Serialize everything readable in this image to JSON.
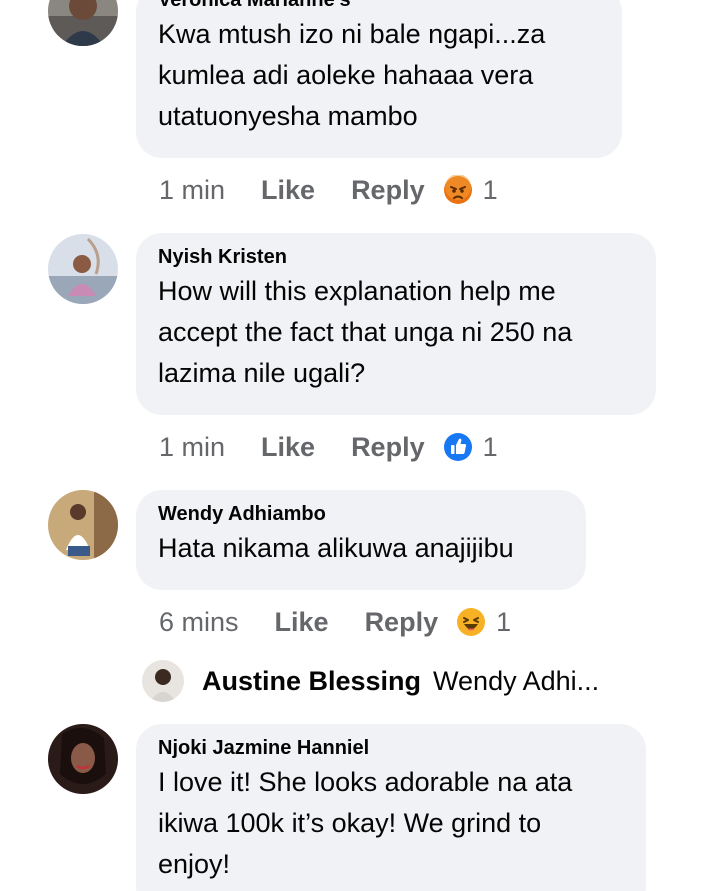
{
  "comments": [
    {
      "author": "Veronica Marianne's",
      "lines": [
        "Kwa mtush izo ni bale ngapi...za",
        "kumlea adi aoleke hahaaa vera",
        "utatuonyesha mambo"
      ],
      "time": "1 min",
      "like": "Like",
      "reply": "Reply",
      "reaction_icon": "angry-emoji-icon",
      "reaction_count": "1"
    },
    {
      "author": "Nyish Kristen",
      "lines": [
        "How will this explanation help me",
        "accept the fact that unga ni 250 na",
        "lazima nile ugali?"
      ],
      "time": "1 min",
      "like": "Like",
      "reply": "Reply",
      "reaction_icon": "thumbs-up-icon",
      "reaction_count": "1"
    },
    {
      "author": "Wendy Adhiambo",
      "lines": [
        "Hata nikama alikuwa anajijibu"
      ],
      "time": "6 mins",
      "like": "Like",
      "reply": "Reply",
      "reaction_icon": "laughing-emoji-icon",
      "reaction_count": "1"
    },
    {
      "author": "Njoki Jazmine Hanniel",
      "lines": [
        "I love it! She looks adorable na ata",
        "ikiwa 100k it’s okay! We grind to",
        "enjoy!"
      ]
    }
  ],
  "reply_preview": {
    "name": "Austine Blessing",
    "text": "Wendy Adhi..."
  },
  "colors": {
    "bubble": "#f0f2f5",
    "meta_text": "#65676b",
    "like_blue": "#1877f2",
    "angry": "#e9710f",
    "haha": "#f7b125"
  }
}
